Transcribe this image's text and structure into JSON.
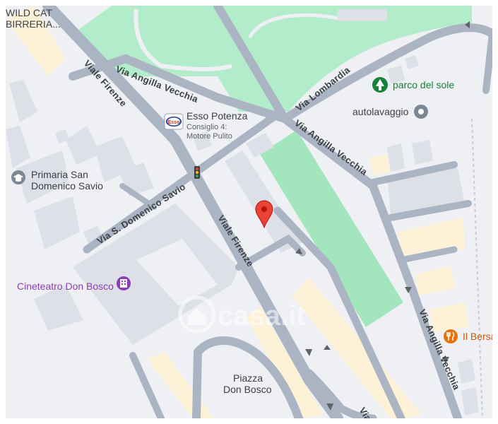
{
  "map": {
    "roads": {
      "viale_firenze_upper": "Viale Firenze",
      "viale_firenze_lower": "Viale Firenze",
      "viale_firenze_bottom": "Via",
      "via_angilla_vecchia_nw": "Via Angilla Vecchia",
      "via_angilla_vecchia_ne": "Via Angilla Vecchia",
      "via_angilla_vecchia_se": "Via Angilla Vecchia",
      "via_lombardia": "Via Lombardia",
      "via_s_domenico_savio": "Via S. Domenico Savio"
    },
    "pois": {
      "wild_cat_line1": "WILD CAT",
      "wild_cat_line2": "BIRRERIA...",
      "esso_name": "Esso Potenza",
      "esso_sub1": "Consiglio 4:",
      "esso_sub2": "Motore Pulito",
      "esso_logo": "Esso",
      "primaria_line1": "Primaria San",
      "primaria_line2": "Domenico Savio",
      "parco": "parco del sole",
      "autolavaggio": "autolavaggio",
      "cineteatro": "Cineteatro Don Bosco",
      "piazza_line1": "Piazza",
      "piazza_line2": "Don Bosco",
      "bersa": "Il Bersa"
    },
    "watermark": "casa.it",
    "icons": {
      "marker": "location-pin-icon",
      "traffic_light": "traffic-light-icon",
      "tree": "park-tree-icon",
      "car_wash": "car-wash-icon",
      "theater": "theater-icon",
      "restaurant": "restaurant-icon",
      "school": "school-icon",
      "fuel": "esso-logo-icon"
    },
    "colors": {
      "background": "#eef0f3",
      "road": "#aab4c3",
      "park": "#b3eccb",
      "sports_field": "#a3e5bd",
      "building": "#dde0e6",
      "commercial": "#fdf1d8",
      "marker": "#ea4335"
    }
  }
}
